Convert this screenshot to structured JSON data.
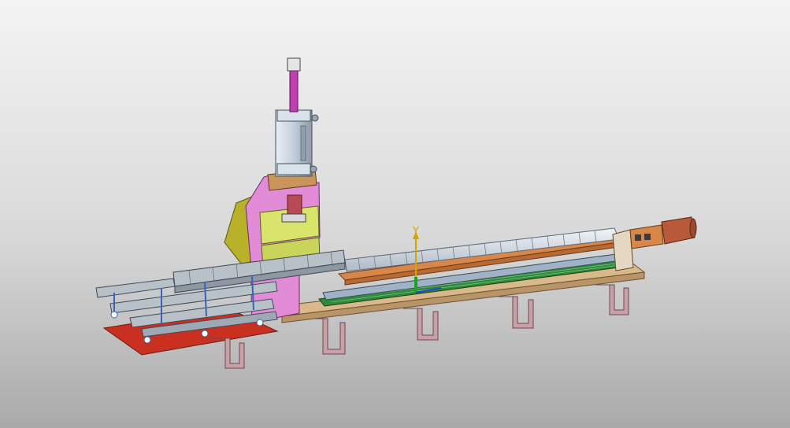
{
  "viewport": {
    "background_top": "#f4f4f4",
    "background_bottom": "#a9a9a9"
  },
  "triad": {
    "y_label": "Y",
    "y_axis_color": "#d8a300",
    "z_axis_color": "#1aa81a",
    "x_axis_color": "#2a3fd6"
  },
  "model": {
    "description_icon": "3d-assembly-model",
    "colors": {
      "cylinder": "#c9d6e3",
      "rod": "#c23fb3",
      "frame_pink": "#e28bd6",
      "plate_yellow": "#d9e46a",
      "olive_bracket": "#b9b12a",
      "rail_gray": "#b9c1c8",
      "rail_blue": "#3a63b7",
      "base_tan": "#d9b889",
      "cable_chain": "#d8e0ea",
      "slide_orange": "#d8874b",
      "motor": "#b85a3a",
      "legs": "#caa0a8",
      "pcb_green": "#2f8a3c",
      "red_plate": "#c9301f"
    }
  }
}
